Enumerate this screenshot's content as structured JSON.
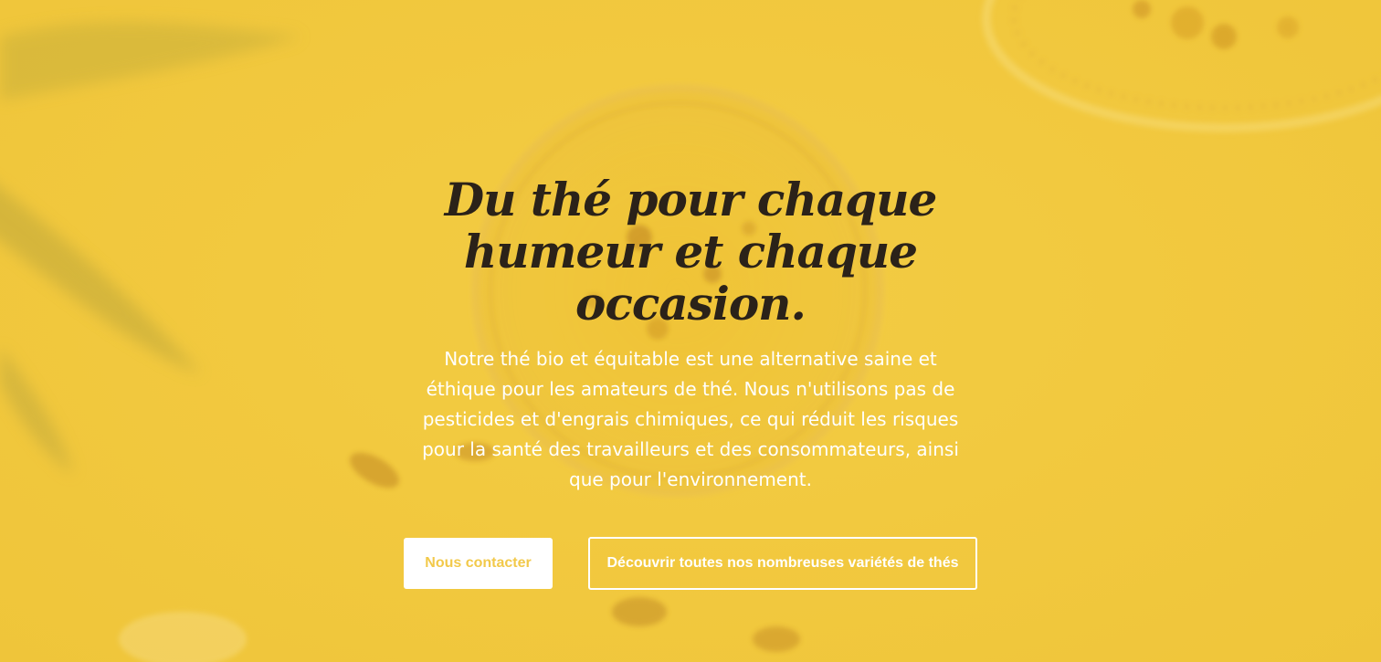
{
  "hero": {
    "title": "Du thé pour chaque humeur et chaque occasion.",
    "subtitle": "Notre thé bio et équitable est une alternative saine et éthique pour les amateurs de thé. Nous n'utilisons pas de pesticides et d'engrais chimiques, ce qui réduit les risques pour la santé des travailleurs et des consommateurs, ainsi que pour l'environnement.",
    "primary_button_label": "Nous contacter",
    "secondary_button_label": "Découvrir toutes nos nombreuses variétés de thés"
  },
  "colors": {
    "background": "#f2c940",
    "title": "#2b2219",
    "text": "#ffffff",
    "primary_button_text": "#f2c94a"
  }
}
